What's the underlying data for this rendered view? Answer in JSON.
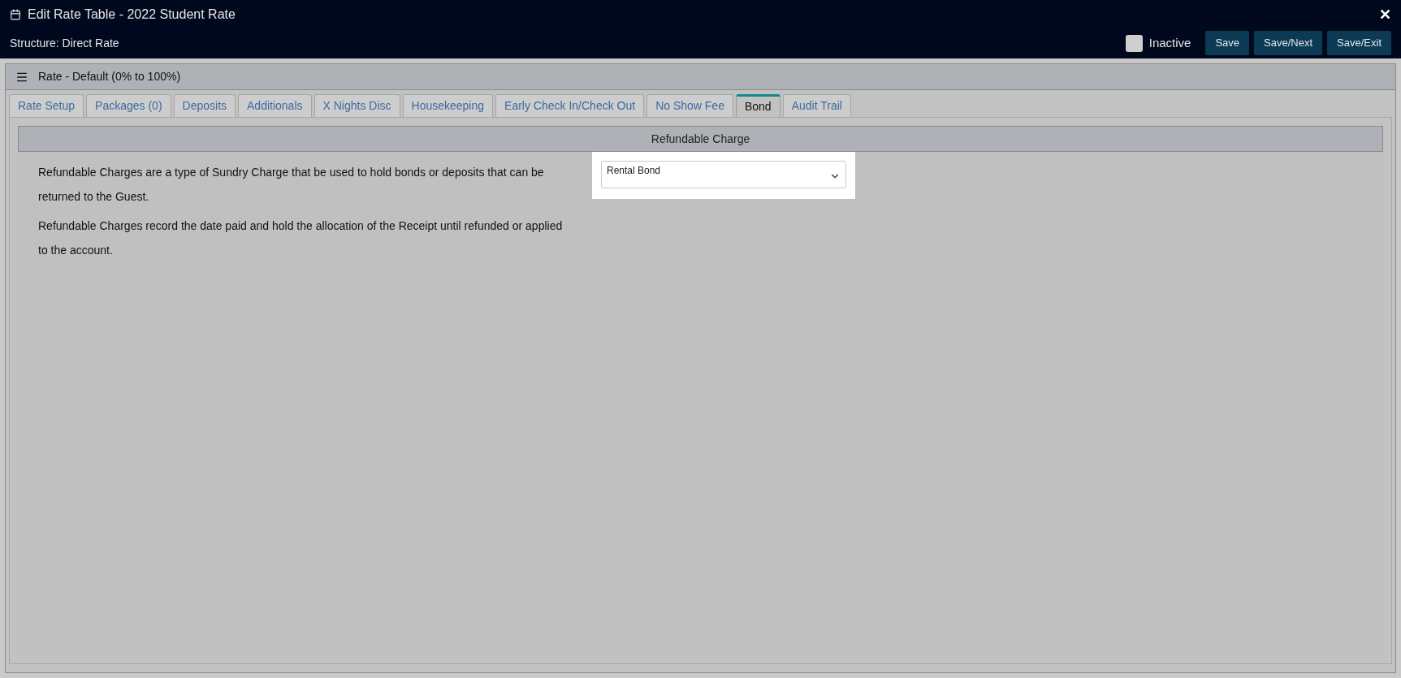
{
  "window": {
    "title": "Edit Rate Table - 2022 Student Rate",
    "subtitle": "Structure: Direct Rate",
    "close": "✕"
  },
  "toolbar": {
    "inactive": {
      "label": "Inactive",
      "checked": false
    },
    "buttons": [
      "Save",
      "Save/Next",
      "Save/Exit"
    ]
  },
  "panel": {
    "title": "Rate - Default (0% to 100%)"
  },
  "tabs": [
    {
      "label": "Rate Setup",
      "selected": false
    },
    {
      "label": "Packages (0)",
      "selected": false
    },
    {
      "label": "Deposits",
      "selected": false
    },
    {
      "label": "Additionals",
      "selected": false
    },
    {
      "label": "X Nights Disc",
      "selected": false
    },
    {
      "label": "Housekeeping",
      "selected": false
    },
    {
      "label": "Early Check In/Check Out",
      "selected": false
    },
    {
      "label": "No Show Fee",
      "selected": false
    },
    {
      "label": "Bond",
      "selected": true
    },
    {
      "label": "Audit Trail",
      "selected": false
    }
  ],
  "section": {
    "title": "Refundable Charge",
    "paragraphs": [
      "Refundable Charges are a type of Sundry Charge that be used to hold bonds or deposits that can be returned to the Guest.",
      "Refundable Charges record the date paid and hold the allocation of the Receipt until refunded or applied to the account."
    ],
    "select": {
      "value": "Rental Bond"
    }
  }
}
